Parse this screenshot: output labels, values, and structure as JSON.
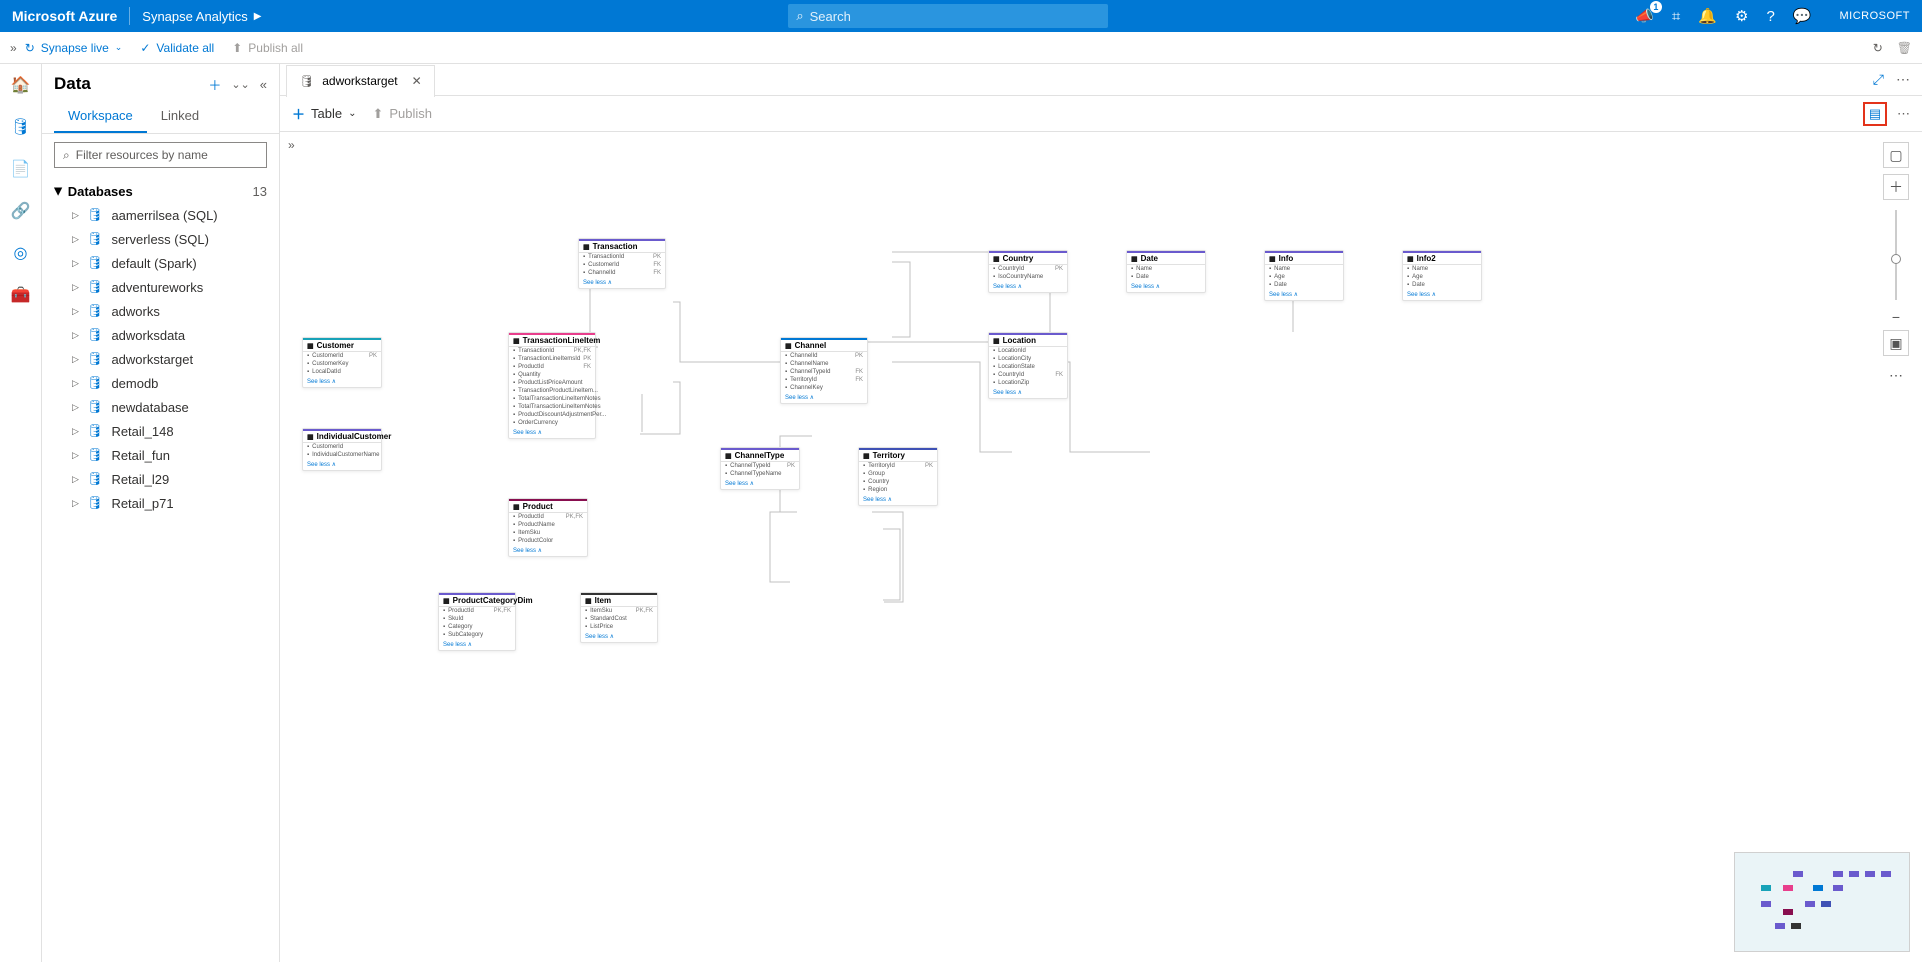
{
  "header": {
    "brand": "Microsoft Azure",
    "product": "Synapse Analytics",
    "search_placeholder": "Search",
    "notif_badge": "1",
    "account": "MICROSOFT"
  },
  "sec_toolbar": {
    "synapse_mode": "Synapse live",
    "validate": "Validate all",
    "publish": "Publish all"
  },
  "panel": {
    "title": "Data",
    "tab_workspace": "Workspace",
    "tab_linked": "Linked",
    "filter_placeholder": "Filter resources by name",
    "group_name": "Databases",
    "group_count": "13",
    "items": [
      "aamerrilsea (SQL)",
      "serverless (SQL)",
      "default (Spark)",
      "adventureworks",
      "adworks",
      "adworksdata",
      "adworkstarget",
      "demodb",
      "newdatabase",
      "Retail_148",
      "Retail_fun",
      "Retail_l29",
      "Retail_p71"
    ]
  },
  "workspace": {
    "tab_label": "adworkstarget",
    "add_table": "Table",
    "publish": "Publish"
  },
  "entities": {
    "transaction": {
      "name": "Transaction",
      "rows": [
        [
          "TransactionId",
          "PK"
        ],
        [
          "CustomerId",
          "FK"
        ],
        [
          "ChannelId",
          "FK"
        ]
      ],
      "bar": "#6a5acd"
    },
    "customer": {
      "name": "Customer",
      "rows": [
        [
          "CustomerId",
          "PK"
        ],
        [
          "CustomerKey",
          ""
        ],
        [
          "LocalDatId",
          ""
        ]
      ],
      "bar": "#17a2b8"
    },
    "individual_customer": {
      "name": "IndividualCustomer",
      "rows": [
        [
          "CustomerId",
          ""
        ],
        [
          "IndividualCustomerName",
          ""
        ]
      ],
      "bar": "#6a5acd"
    },
    "txlineitem": {
      "name": "TransactionLineItem",
      "rows": [
        [
          "TransactionId",
          "PK,FK"
        ],
        [
          "TransactionLineItemsId",
          "PK"
        ],
        [
          "ProductId",
          "FK"
        ],
        [
          "Quantity",
          ""
        ],
        [
          "ProductListPriceAmount",
          ""
        ],
        [
          "TransactionProductLineItem...",
          ""
        ],
        [
          "TotalTransactionLineItemNotes",
          ""
        ],
        [
          "TotalTransactionLineItemNotes",
          ""
        ],
        [
          "ProductDiscountAdjustmentPer...",
          ""
        ],
        [
          "OrderCurrency",
          ""
        ]
      ],
      "bar": "#e83e8c"
    },
    "channel": {
      "name": "Channel",
      "rows": [
        [
          "ChannelId",
          "PK"
        ],
        [
          "ChannelName",
          ""
        ],
        [
          "ChannelTypeId",
          "FK"
        ],
        [
          "TerritoryId",
          "FK"
        ],
        [
          "ChannelKey",
          ""
        ]
      ],
      "bar": "#0078d4"
    },
    "channeltype": {
      "name": "ChannelType",
      "rows": [
        [
          "ChannelTypeId",
          "PK"
        ],
        [
          "ChannelTypeName",
          ""
        ]
      ],
      "bar": "#6a5acd"
    },
    "territory": {
      "name": "Territory",
      "rows": [
        [
          "TerritoryId",
          "PK"
        ],
        [
          "Group",
          ""
        ],
        [
          "Country",
          ""
        ],
        [
          "Region",
          ""
        ]
      ],
      "bar": "#3f51b5"
    },
    "product": {
      "name": "Product",
      "rows": [
        [
          "ProductId",
          "PK,FK"
        ],
        [
          "ProductName",
          ""
        ],
        [
          "ItemSku",
          ""
        ],
        [
          "ProductColor",
          ""
        ]
      ],
      "bar": "#880e4f"
    },
    "prodcat": {
      "name": "ProductCategoryDim",
      "rows": [
        [
          "ProductId",
          "PK,FK"
        ],
        [
          "SkuId",
          ""
        ],
        [
          "Category",
          ""
        ],
        [
          "SubCategory",
          ""
        ]
      ],
      "bar": "#6a5acd"
    },
    "item": {
      "name": "Item",
      "rows": [
        [
          "ItemSku",
          "PK,FK"
        ],
        [
          "StandardCost",
          ""
        ],
        [
          "ListPrice",
          ""
        ]
      ],
      "bar": "#333"
    },
    "country": {
      "name": "Country",
      "rows": [
        [
          "CountryId",
          "PK"
        ],
        [
          "IsoCountryName",
          ""
        ]
      ],
      "bar": "#6a5acd"
    },
    "location": {
      "name": "Location",
      "rows": [
        [
          "LocationId",
          ""
        ],
        [
          "LocationCity",
          ""
        ],
        [
          "LocationState",
          ""
        ],
        [
          "CountryId",
          "FK"
        ],
        [
          "LocationZip",
          ""
        ]
      ],
      "bar": "#6a5acd"
    },
    "date": {
      "name": "Date",
      "rows": [
        [
          "Name",
          ""
        ],
        [
          "Date",
          ""
        ]
      ],
      "bar": "#6a5acd"
    },
    "info": {
      "name": "Info",
      "rows": [
        [
          "Name",
          ""
        ],
        [
          "Age",
          ""
        ],
        [
          "Date",
          ""
        ]
      ],
      "bar": "#6a5acd"
    },
    "info2": {
      "name": "Info2",
      "rows": [
        [
          "Name",
          ""
        ],
        [
          "Age",
          ""
        ],
        [
          "Date",
          ""
        ]
      ],
      "bar": "#6a5acd"
    },
    "seemore": "See less  ∧"
  }
}
